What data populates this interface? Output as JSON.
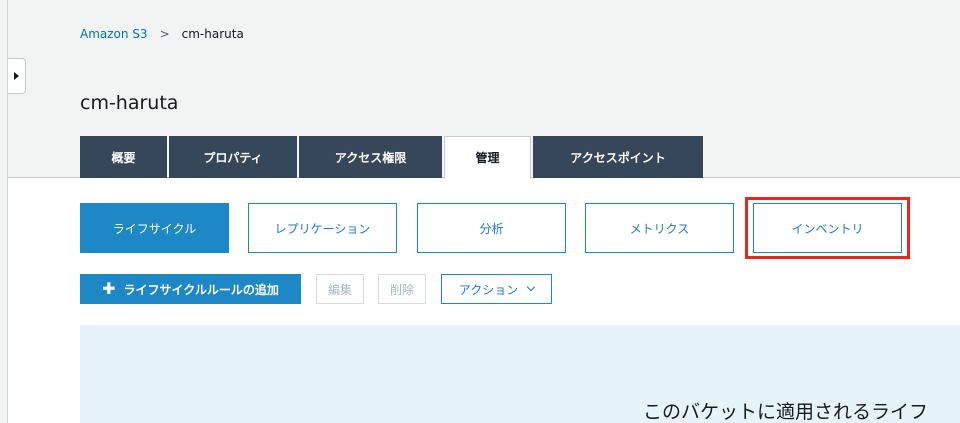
{
  "breadcrumb": {
    "root": "Amazon S3",
    "separator": ">",
    "current": "cm-haruta"
  },
  "page_title": "cm-haruta",
  "tabs": [
    {
      "label": "概要"
    },
    {
      "label": "プロパティ"
    },
    {
      "label": "アクセス権限"
    },
    {
      "label": "管理",
      "active": true
    },
    {
      "label": "アクセスポイント"
    }
  ],
  "subtabs": [
    {
      "label": "ライフサイクル",
      "active": true
    },
    {
      "label": "レプリケーション"
    },
    {
      "label": "分析"
    },
    {
      "label": "メトリクス"
    },
    {
      "label": "インベントリ"
    }
  ],
  "toolbar": {
    "add_label": "ライフサイクルルールの追加",
    "edit_label": "編集",
    "delete_label": "削除",
    "action_label": "アクション"
  },
  "info_text": "このバケットに適用されるライフ",
  "colors": {
    "accent": "#1e88c7",
    "tab_dark": "#37475a",
    "highlight": "#e8281e",
    "panel": "#e6f3fb"
  },
  "icons": {
    "toggle": "caret-right-icon",
    "add": "plus-icon",
    "dropdown": "chevron-down-icon"
  }
}
